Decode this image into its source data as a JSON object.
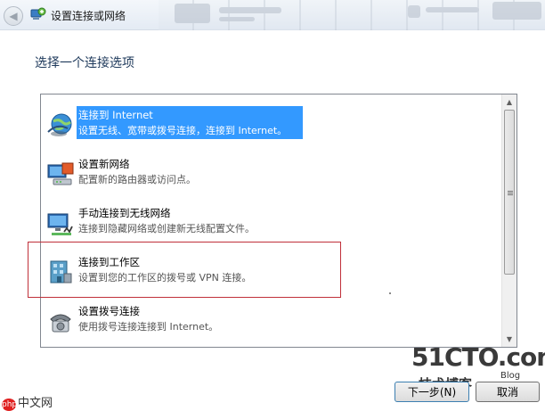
{
  "window": {
    "title": "设置连接或网络"
  },
  "heading": "选择一个连接选项",
  "options": [
    {
      "title": "连接到 Internet",
      "desc": "设置无线、宽带或拨号连接，连接到 Internet。",
      "icon": "globe-icon",
      "selected": true
    },
    {
      "title": "设置新网络",
      "desc": "配置新的路由器或访问点。",
      "icon": "router-icon",
      "selected": false
    },
    {
      "title": "手动连接到无线网络",
      "desc": "连接到隐藏网络或创建新无线配置文件。",
      "icon": "wireless-network-icon",
      "selected": false
    },
    {
      "title": "连接到工作区",
      "desc": "设置到您的工作区的拨号或 VPN 连接。",
      "icon": "workplace-icon",
      "selected": false
    },
    {
      "title": "设置拨号连接",
      "desc": "使用拨号连接连接到 Internet。",
      "icon": "telephone-icon",
      "selected": false
    }
  ],
  "buttons": {
    "next": "下一步(N)",
    "cancel": "取消"
  },
  "watermarks": {
    "site": "51CTO.com",
    "site_sub": "技术博客",
    "site_blog": "Blog",
    "php": "中文网",
    "php_badge": "php"
  },
  "colors": {
    "selection": "#3399ff",
    "highlight_border": "#c0303a",
    "heading": "#1e395b"
  }
}
